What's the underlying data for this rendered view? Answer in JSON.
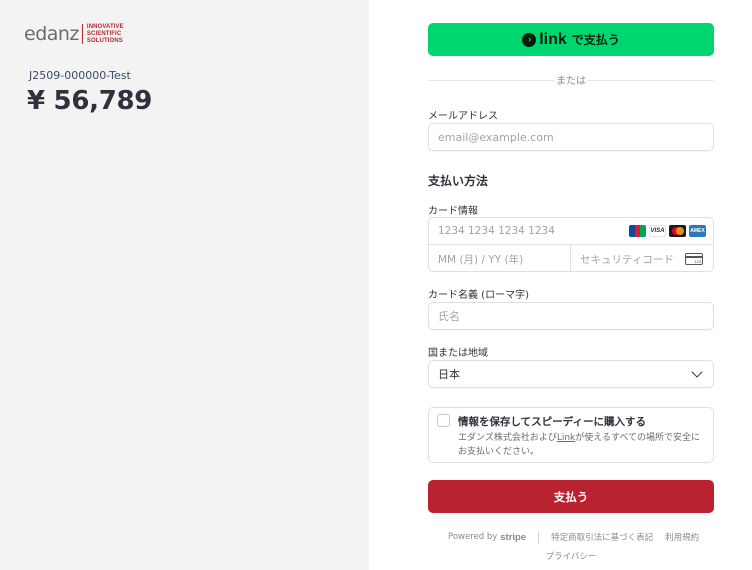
{
  "merchant": {
    "logo_word": "edanz",
    "logo_tag": [
      "INNOVATIVE",
      "SCIENTIFIC",
      "SOLUTIONS"
    ],
    "order_id": "J2509-000000-Test",
    "amount": "¥ 56,789"
  },
  "link_button": {
    "brand": "link",
    "label": "で支払う",
    "colors": {
      "background": "#00d66f",
      "text": "#011e0f"
    }
  },
  "divider": {
    "or_text": "または"
  },
  "email": {
    "label": "メールアドレス",
    "placeholder": "email@example.com",
    "value": ""
  },
  "payment_method": {
    "title": "支払い方法",
    "card_info_label": "カード情報",
    "card_number_placeholder": "1234 1234 1234 1234",
    "expiry_placeholder": "MM (月) / YY (年)",
    "cvc_placeholder": "セキュリティコード",
    "brands": [
      "jcb-icon",
      "visa-icon",
      "mastercard-icon",
      "amex-icon"
    ],
    "visa_text": "VISA",
    "amex_text": "AMEX",
    "cvc_icon_text": "123",
    "cardholder_label": "カード名義 (ローマ字)",
    "cardholder_placeholder": "氏名",
    "country_label": "国または地域",
    "country_value": "日本"
  },
  "save_info": {
    "title": "情報を保存してスピーディーに購入する",
    "desc_before": "エダンズ株式会社および",
    "desc_link": "Link",
    "desc_after": "が使えるすべての場所で安全にお支払いください。",
    "checked": false
  },
  "pay_button": {
    "label": "支払う",
    "color": "#b8232f"
  },
  "footer": {
    "powered_by": "Powered by",
    "stripe": "stripe",
    "legal": "特定商取引法に基づく表記",
    "terms": "利用規約",
    "privacy": "プライバシー"
  }
}
